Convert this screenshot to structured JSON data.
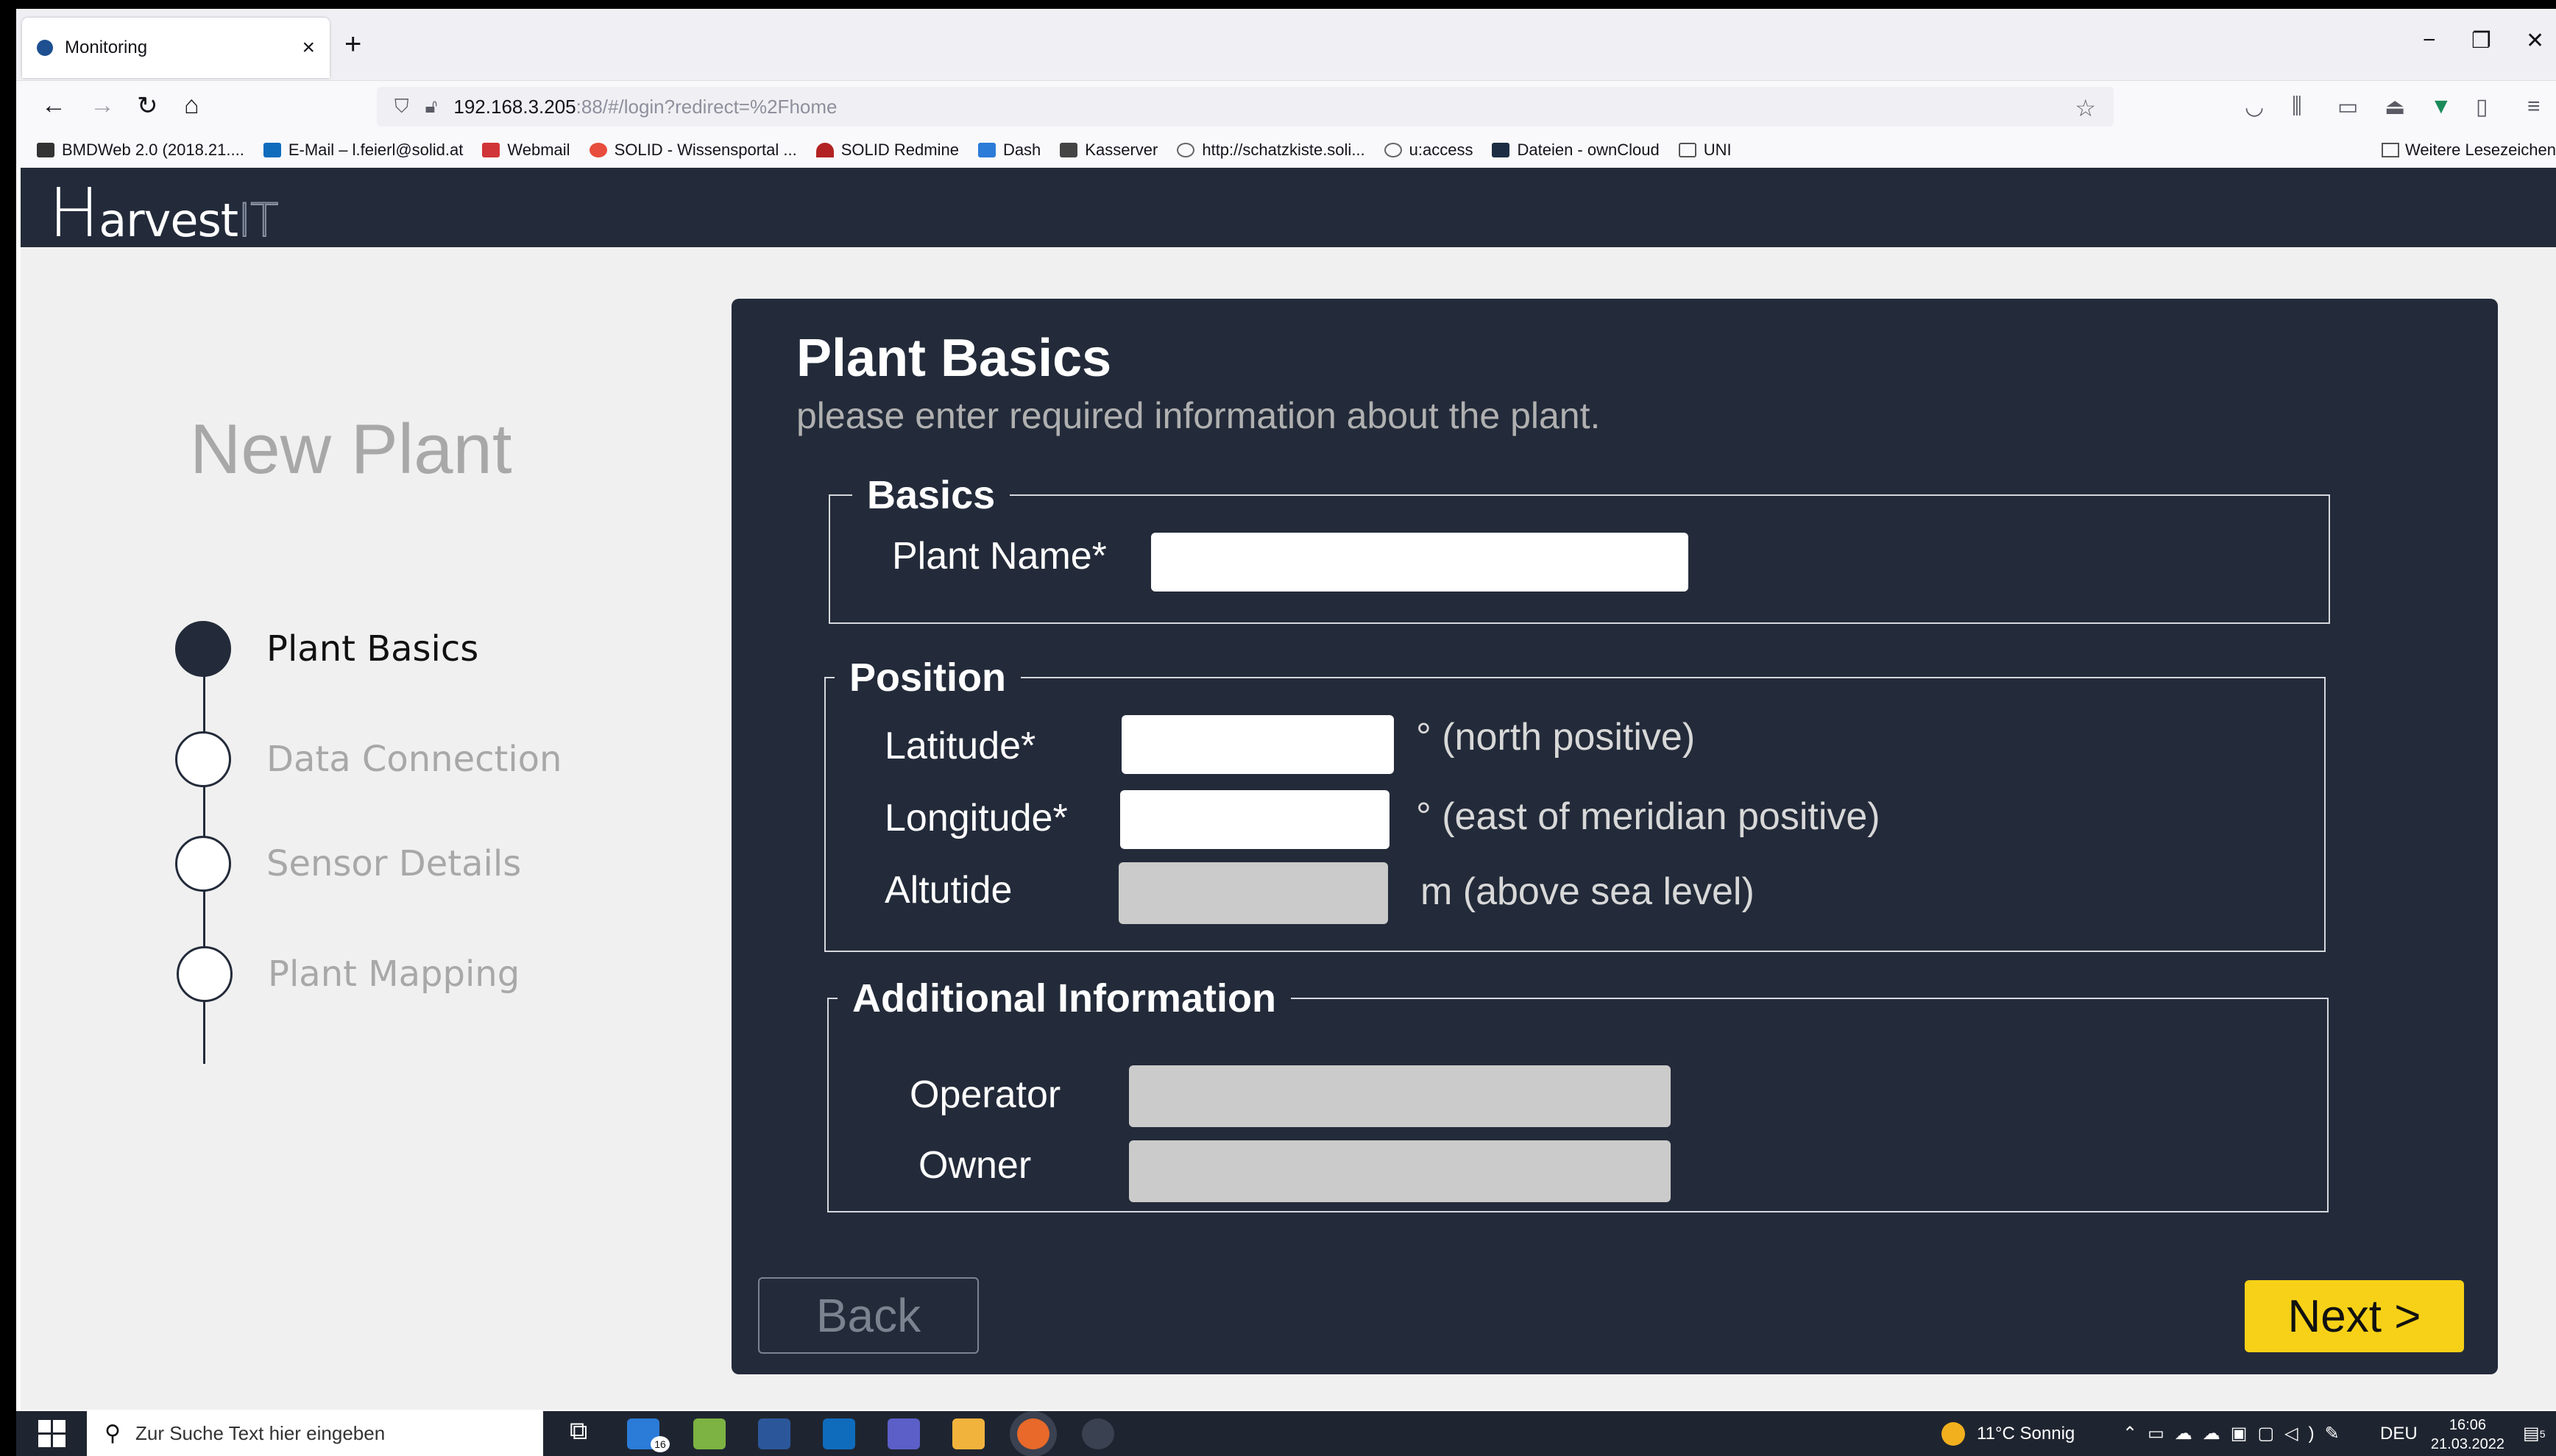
{
  "browser": {
    "tab_title": "Monitoring",
    "tab_close": "×",
    "new_tab": "+",
    "url_host": "192.168.3.205",
    "url_path": ":88/#/login?redirect=%2Fhome",
    "win_minimize": "−",
    "win_restore": "❐",
    "win_close": "✕"
  },
  "bookmarks": [
    {
      "label": "BMDWeb 2.0 (2018.21....",
      "color": "#333333"
    },
    {
      "label": "E-Mail – l.feierl@solid.at",
      "color": "#0f6cbd"
    },
    {
      "label": "Webmail",
      "color": "#d13438"
    },
    {
      "label": "SOLID - Wissensportal ...",
      "color": "#e74c3c"
    },
    {
      "label": "SOLID Redmine",
      "color": "#b22222"
    },
    {
      "label": "Dash",
      "color": "#2b7bd8"
    },
    {
      "label": "Kasserver",
      "color": "#444444"
    },
    {
      "label": "http://schatzkiste.soli...",
      "color": "#666666"
    },
    {
      "label": "u:access",
      "color": "#666666"
    },
    {
      "label": "Dateien - ownCloud",
      "color": "#1d2d44"
    },
    {
      "label": "UNI",
      "color": "#666666"
    }
  ],
  "bookmarks_other": "Weitere Lesezeichen",
  "app": {
    "logo_h": "H",
    "logo_rest": "arvest",
    "logo_it": "IT"
  },
  "wizard": {
    "heading": "New Plant",
    "steps": [
      {
        "label": "Plant Basics",
        "active": true
      },
      {
        "label": "Data Connection",
        "active": false
      },
      {
        "label": "Sensor Details",
        "active": false
      },
      {
        "label": "Plant Mapping",
        "active": false
      }
    ]
  },
  "form": {
    "title": "Plant Basics",
    "subtitle": "please enter required information about the plant.",
    "basics": {
      "legend": "Basics",
      "plant_name_label": "Plant Name*",
      "plant_name_value": ""
    },
    "position": {
      "legend": "Position",
      "latitude_label": "Latitude*",
      "latitude_value": "",
      "latitude_unit": "° (north positive)",
      "longitude_label": "Longitude*",
      "longitude_value": "",
      "longitude_unit": "° (east of meridian positive)",
      "altitude_label": "Altutide",
      "altitude_value": "",
      "altitude_unit": "m (above sea level)"
    },
    "additional": {
      "legend": "Additional Information",
      "operator_label": "Operator",
      "operator_value": "",
      "owner_label": "Owner",
      "owner_value": ""
    },
    "back_label": "Back",
    "next_label": "Next >"
  },
  "taskbar": {
    "search_placeholder": "Zur Suche Text hier eingeben",
    "todo_badge": "16",
    "weather": "11°C  Sonnig",
    "language": "DEU",
    "time": "16:06",
    "date": "21.03.2022",
    "notifications": "5"
  },
  "colors": {
    "header_bg": "#232b3a",
    "panel_bg": "#232b3a",
    "accent": "#f7d117",
    "page_bg": "#f0f0f0"
  }
}
